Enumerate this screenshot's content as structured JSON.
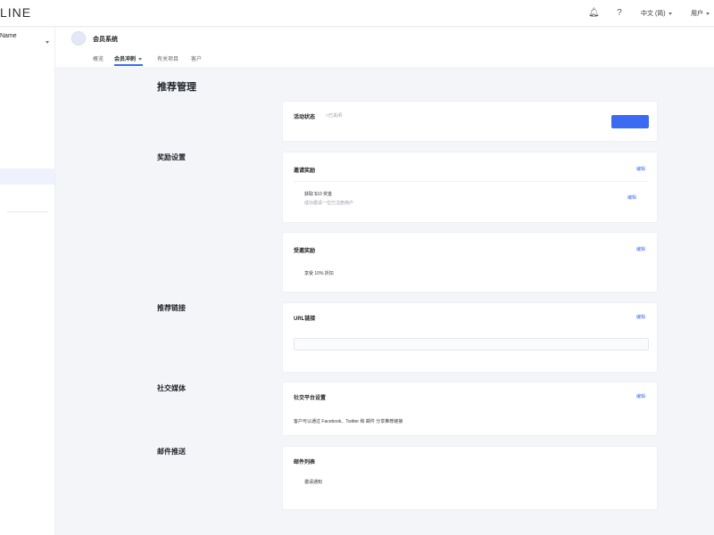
{
  "topbar": {
    "logo": "LINE",
    "lang": "中文 (简)",
    "user": "用户"
  },
  "sidebar": {
    "workspace_name": "Name"
  },
  "header": {
    "system_title": "会员系统",
    "tabs": [
      {
        "label": "概览"
      },
      {
        "label": "会员冲刺"
      },
      {
        "label": "有关项目"
      },
      {
        "label": "客户"
      }
    ]
  },
  "page": {
    "title": "推荐管理"
  },
  "sections": {
    "activation": {
      "card_title": "活动状态",
      "status_tag": "□已关闭"
    },
    "rewards": {
      "title": "奖励设置",
      "inviter_card_title": "邀请奖励",
      "edit_label": "编辑",
      "inviter_item": "获取 $10 奖金",
      "inviter_item_desc": "成功邀请一位已注册用户",
      "invitee_card_title": "受邀奖励",
      "invitee_item": "享受 10% 折扣"
    },
    "referral_link": {
      "title": "推荐链接",
      "card_title": "URL链接",
      "edit_label": "编辑"
    },
    "social": {
      "title": "社交媒体",
      "card_title": "社交平台设置",
      "edit_label": "编辑",
      "card_text": "客户可以通过 Facebook、Twitter 和 邮件 分享推荐链接"
    },
    "email": {
      "title": "邮件推送",
      "card_title": "邮件列表",
      "item_title": "邀请通知"
    }
  },
  "colors": {
    "accent": "#3b6bf2",
    "page_bg": "#f4f5f8",
    "card_bg": "#ffffff"
  }
}
